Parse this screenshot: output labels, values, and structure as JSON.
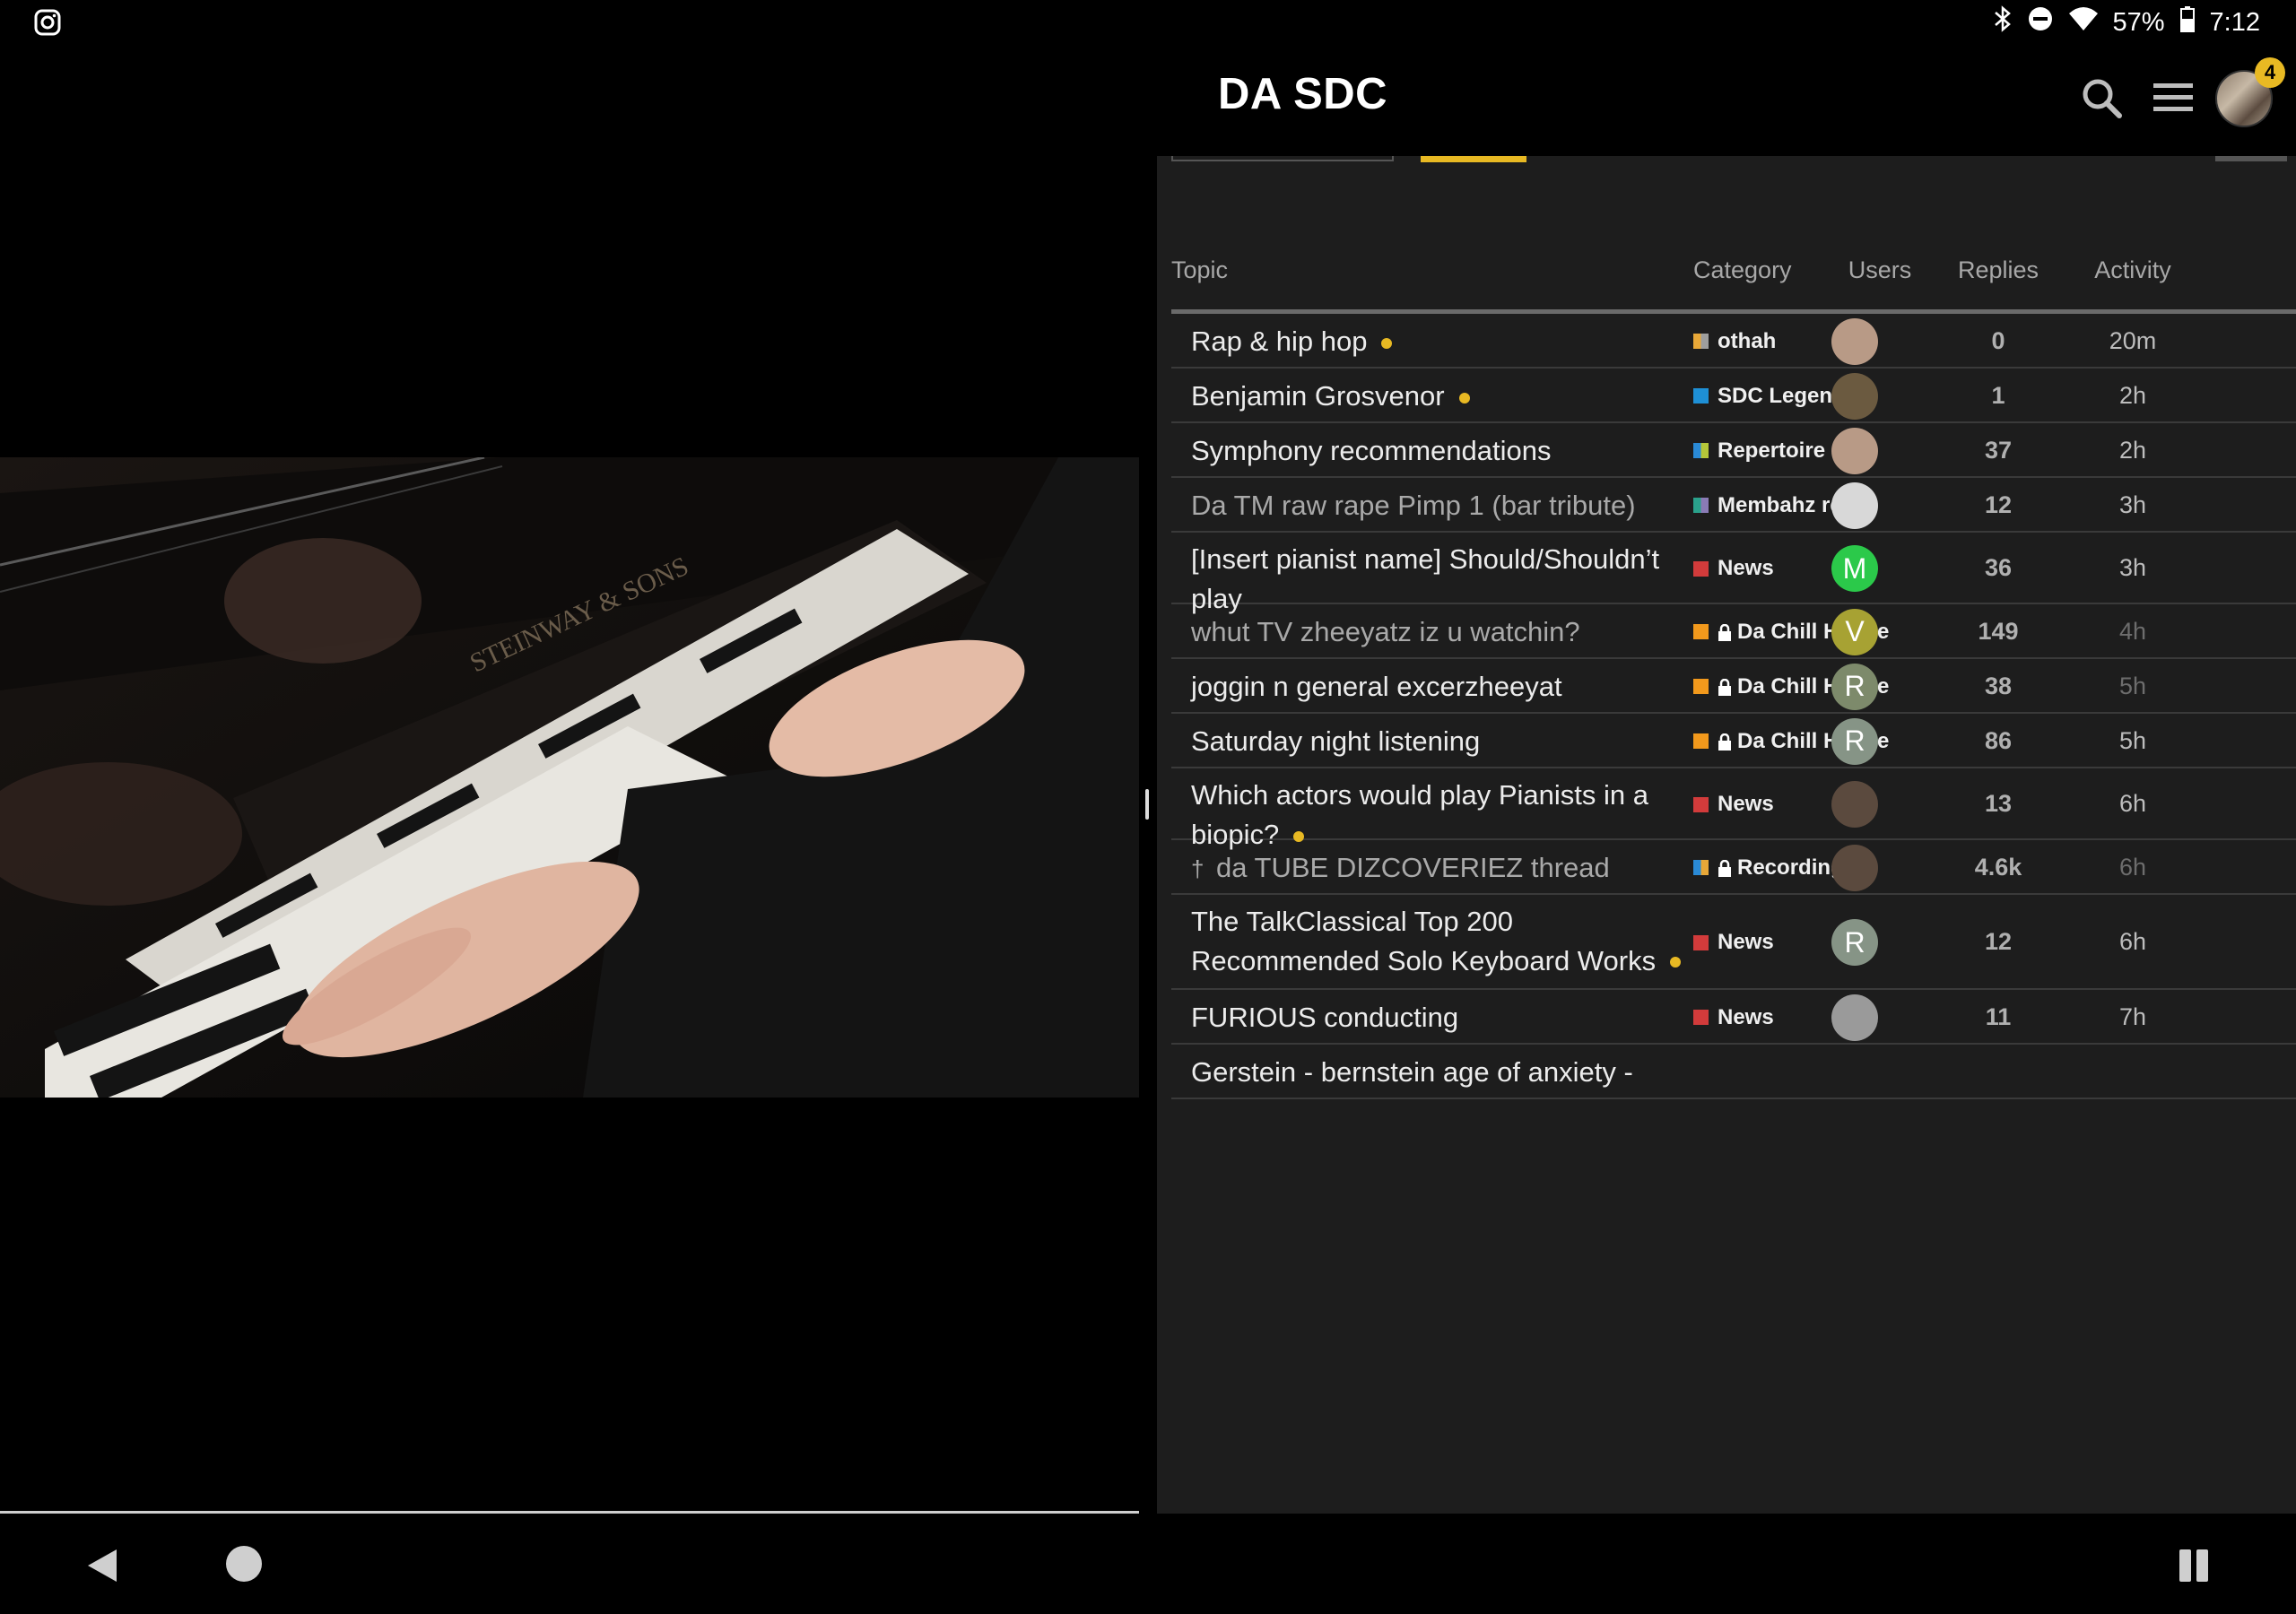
{
  "status_bar": {
    "battery": "57%",
    "time": "7:12"
  },
  "header": {
    "title": "DA SDC",
    "notification_count": "4"
  },
  "table": {
    "columns": {
      "topic": "Topic",
      "category": "Category",
      "users": "Users",
      "replies": "Replies",
      "activity": "Activity"
    },
    "rows": [
      {
        "title": "Rap & hip hop",
        "unread": true,
        "read": false,
        "pinned": false,
        "category": "othah",
        "cat_colors": [
          "#e8a838",
          "#9e9e9e"
        ],
        "locked": false,
        "avatar": {
          "letter": "",
          "color": "#b89a86"
        },
        "replies": "0",
        "activity": "20m",
        "activity_dim": false
      },
      {
        "title": "Benjamin Grosvenor",
        "unread": true,
        "read": false,
        "pinned": false,
        "category": "SDC Legendz",
        "cat_colors": [
          "#1e90d6",
          "#1e90d6"
        ],
        "locked": false,
        "avatar": {
          "letter": "",
          "color": "#6b5a40"
        },
        "replies": "1",
        "activity": "2h",
        "activity_dim": false
      },
      {
        "title": "Symphony recommendations",
        "unread": false,
        "read": false,
        "pinned": false,
        "category": "Repertoire",
        "cat_colors": [
          "#2a8ad6",
          "#b5c739"
        ],
        "locked": false,
        "avatar": {
          "letter": "",
          "color": "#b89a86"
        },
        "replies": "37",
        "activity": "2h",
        "activity_dim": false
      },
      {
        "title": "Da TM raw rape Pimp 1 (bar tribute)",
        "unread": false,
        "read": true,
        "pinned": false,
        "category": "Membahz recs",
        "cat_colors": [
          "#2aa18b",
          "#8a7bb5"
        ],
        "locked": false,
        "avatar": {
          "letter": "",
          "color": "#d8d8d8"
        },
        "replies": "12",
        "activity": "3h",
        "activity_dim": false
      },
      {
        "title": "[Insert pianist name] Should/Shouldn’t play",
        "unread": false,
        "read": false,
        "pinned": false,
        "category": "News",
        "cat_colors": [
          "#d23b3b",
          "#d23b3b"
        ],
        "locked": false,
        "avatar": {
          "letter": "M",
          "color": "#2bc94a"
        },
        "replies": "36",
        "activity": "3h",
        "activity_dim": false
      },
      {
        "title": "whut TV zheeyatz iz u watchin?",
        "unread": false,
        "read": true,
        "pinned": false,
        "category": "Da Chill House",
        "cat_colors": [
          "#f2991c",
          "#f2991c"
        ],
        "locked": true,
        "avatar": {
          "letter": "V",
          "color": "#a7a233"
        },
        "replies": "149",
        "activity": "4h",
        "activity_dim": true
      },
      {
        "title": "joggin n general excerzheeyat",
        "unread": false,
        "read": false,
        "pinned": false,
        "category": "Da Chill House",
        "cat_colors": [
          "#f2991c",
          "#f2991c"
        ],
        "locked": true,
        "avatar": {
          "letter": "R",
          "color": "#7d8a6b"
        },
        "replies": "38",
        "activity": "5h",
        "activity_dim": true
      },
      {
        "title": "Saturday night listening",
        "unread": false,
        "read": false,
        "pinned": false,
        "category": "Da Chill House",
        "cat_colors": [
          "#f2991c",
          "#f2991c"
        ],
        "locked": true,
        "avatar": {
          "letter": "R",
          "color": "#869486"
        },
        "replies": "86",
        "activity": "5h",
        "activity_dim": false
      },
      {
        "title": "Which actors would play Pianists in a biopic?",
        "unread": true,
        "read": false,
        "pinned": false,
        "category": "News",
        "cat_colors": [
          "#d23b3b",
          "#d23b3b"
        ],
        "locked": false,
        "avatar": {
          "letter": "",
          "color": "#5b4a3e"
        },
        "replies": "13",
        "activity": "6h",
        "activity_dim": false
      },
      {
        "title": "da TUBE DIZCOVERIEZ thread",
        "unread": false,
        "read": true,
        "pinned": true,
        "category": "Recordingz",
        "cat_colors": [
          "#2a8ad6",
          "#e8a838"
        ],
        "locked": true,
        "avatar": {
          "letter": "",
          "color": "#5b4a3e"
        },
        "replies": "4.6k",
        "activity": "6h",
        "activity_dim": true
      },
      {
        "title": "The TalkClassical Top 200 Recommended Solo Keyboard Works",
        "unread": true,
        "read": false,
        "pinned": false,
        "category": "News",
        "cat_colors": [
          "#d23b3b",
          "#d23b3b"
        ],
        "locked": false,
        "avatar": {
          "letter": "R",
          "color": "#869486"
        },
        "replies": "12",
        "activity": "6h",
        "activity_dim": false
      },
      {
        "title": "FURIOUS conducting",
        "unread": false,
        "read": false,
        "pinned": false,
        "category": "News",
        "cat_colors": [
          "#d23b3b",
          "#d23b3b"
        ],
        "locked": false,
        "avatar": {
          "letter": "",
          "color": "#9a9a9a"
        },
        "replies": "11",
        "activity": "7h",
        "activity_dim": false
      },
      {
        "title": "Gerstein - bernstein age of anxiety -",
        "unread": false,
        "read": false,
        "pinned": false,
        "category": "",
        "cat_colors": [
          "#000000",
          "#000000"
        ],
        "locked": false,
        "avatar": {
          "letter": "",
          "color": "#1d1d1d"
        },
        "replies": "",
        "activity": "",
        "activity_dim": false
      }
    ]
  }
}
